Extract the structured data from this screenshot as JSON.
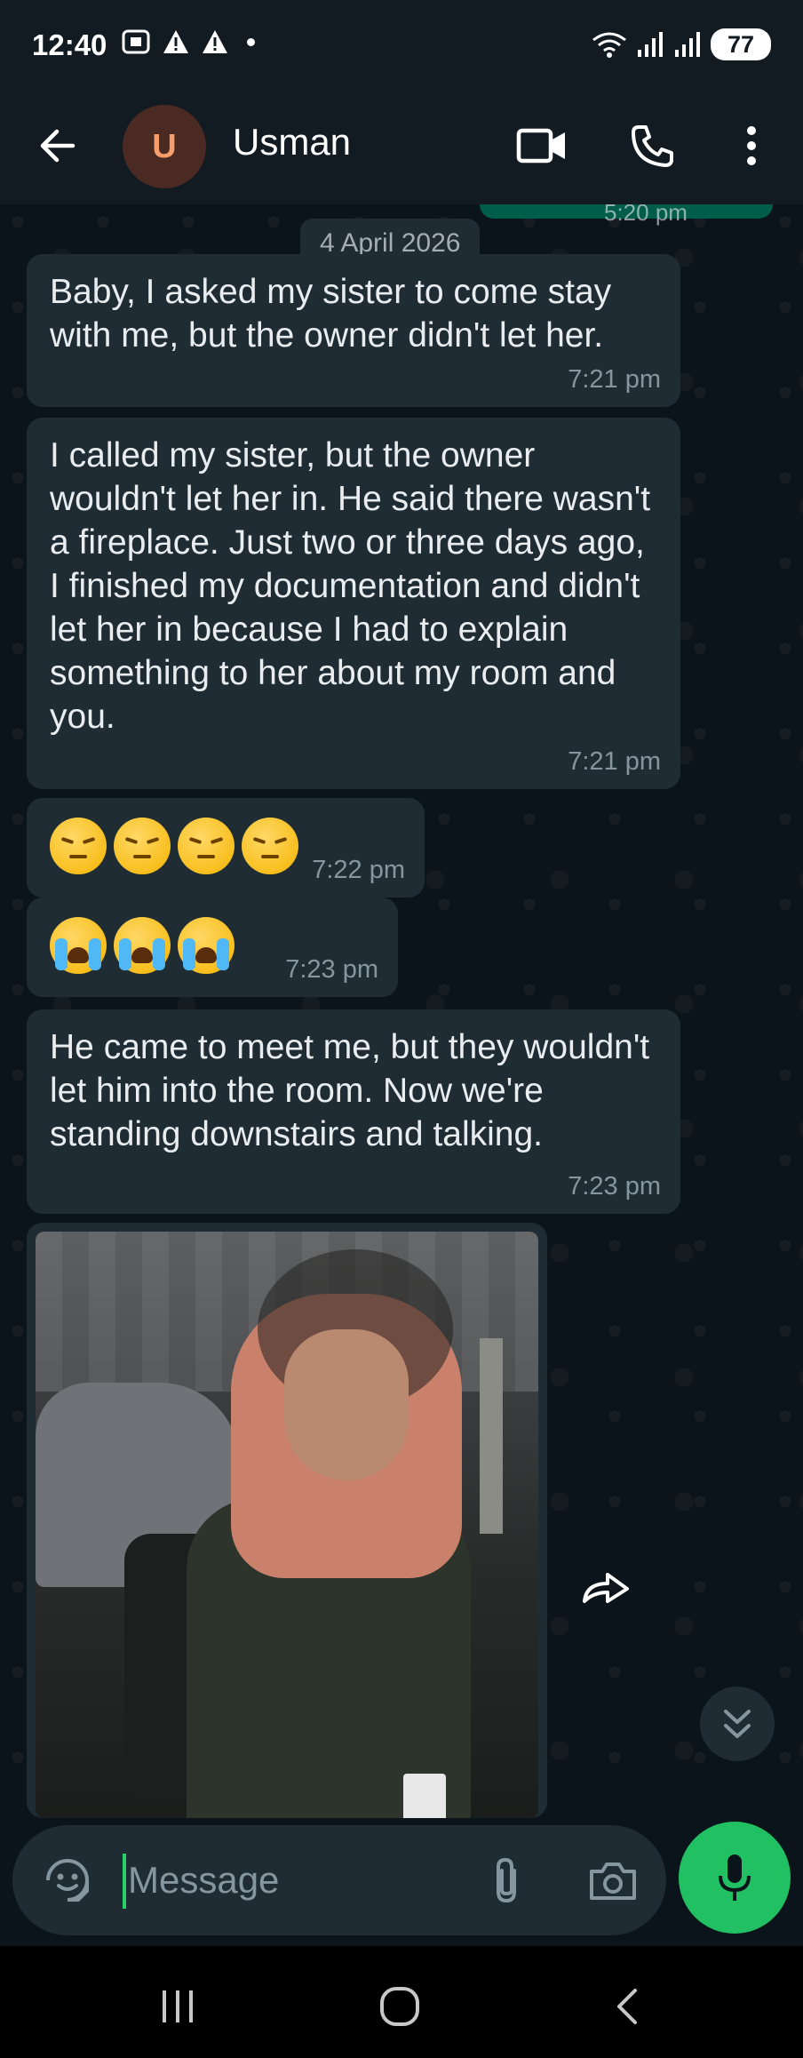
{
  "status_bar": {
    "time": "12:40",
    "battery": "77"
  },
  "header": {
    "avatar_initial": "U",
    "contact_name": "Usman"
  },
  "chat": {
    "previous_time_partial": "5:20 pm",
    "date_chip": "4 April 2026",
    "messages": [
      {
        "text": "Baby, I asked my sister to come stay with me, but the owner didn't let her.",
        "time": "7:21 pm"
      },
      {
        "text": "I called my sister, but the owner wouldn't let her in. He said there wasn't a fireplace. Just two or three days ago, I finished my documentation and didn't let her in because I had to explain something to her about my room and you.",
        "time": "7:21 pm"
      },
      {
        "emoji": "pensive-face",
        "count": 4,
        "time": "7:22 pm"
      },
      {
        "emoji": "loudly-crying-face",
        "count": 3,
        "time": "7:23 pm"
      },
      {
        "text": "He came to meet me, but they wouldn't let him into the room. Now we're standing downstairs and talking.",
        "time": "7:23 pm"
      },
      {
        "type": "image"
      }
    ]
  },
  "composer": {
    "placeholder": "Message"
  },
  "colors": {
    "background": "#0b141a",
    "bar": "#121b22",
    "bubble_incoming": "#1f2c34",
    "bubble_outgoing": "#005c4b",
    "accent": "#21c063"
  },
  "icons": [
    "back-arrow-icon",
    "video-call-icon",
    "phone-icon",
    "more-vert-icon",
    "forward-icon",
    "double-chevron-down-icon",
    "sticker-icon",
    "paperclip-icon",
    "camera-icon",
    "microphone-icon"
  ]
}
